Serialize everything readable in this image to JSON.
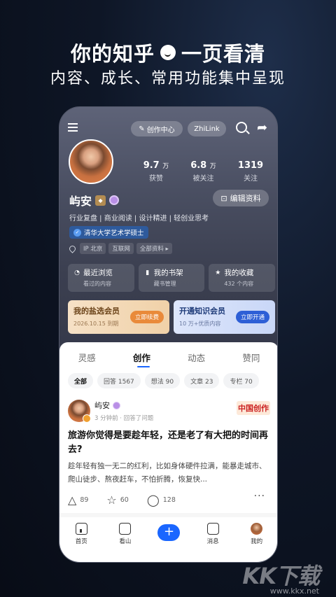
{
  "banner": {
    "title_left": "你的知乎",
    "title_right": "一页看清",
    "subtitle": "内容、成长、常用功能集中呈现"
  },
  "topbar": {
    "create_center": "创作中心",
    "zhilink": "ZhiLink"
  },
  "profile": {
    "name": "屿安",
    "stats": [
      {
        "num": "9.7",
        "unit": "万",
        "label": "获赞"
      },
      {
        "num": "6.8",
        "unit": "万",
        "label": "被关注"
      },
      {
        "num": "1319",
        "unit": "",
        "label": "关注"
      }
    ],
    "edit_label": "编辑资料",
    "tags": "行业复盘 | 商业阅读 | 设计精进 | 轻创业思考",
    "education": "清华大学艺术学硕士",
    "ip": "IP 北京",
    "industry": "互联网",
    "all_info": "全部资料 ▸"
  },
  "quick": [
    {
      "icon": "clock-icon",
      "title": "最近浏览",
      "sub": "看过的内容"
    },
    {
      "icon": "book-icon",
      "title": "我的书架",
      "sub": "藏书管理"
    },
    {
      "icon": "star-icon",
      "title": "我的收藏",
      "sub": "432 个内容"
    }
  ],
  "members": {
    "salt": {
      "title": "我的盐选会员",
      "sub": "2026.10.15 到期",
      "btn": "立即续费"
    },
    "know": {
      "title": "开通知识会员",
      "sub": "10 万+优质内容",
      "btn": "立即开通"
    }
  },
  "tabs": [
    "灵感",
    "创作",
    "动态",
    "赞同"
  ],
  "filters": [
    "全部",
    "回答 1567",
    "想法 90",
    "文章 23",
    "专栏 70"
  ],
  "post": {
    "author": "屿安",
    "time": "3 分钟前 · 回答了问题",
    "sticker": "中国创作",
    "title": "旅游你觉得是要趁年轻，还是老了有大把的时间再去?",
    "body": "趁年轻有独一无二的红利，比如身体硬件拉满，能暴走城市、爬山徒步、熬夜赶车，不怕折腾，恢复快...",
    "likes": "89",
    "stars": "60",
    "comments": "128"
  },
  "nav": [
    "首页",
    "看山",
    "",
    "消息",
    "我的"
  ],
  "watermark": {
    "logo": "KK下载",
    "url": "www.kkx.net"
  }
}
